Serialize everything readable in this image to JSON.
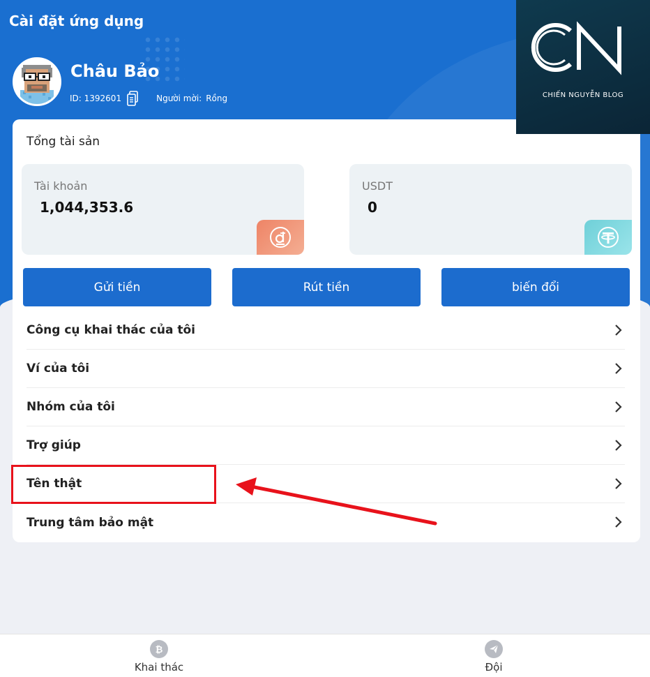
{
  "header": {
    "title": "Cài đặt ứng dụng"
  },
  "profile": {
    "name": "Châu Bảo",
    "id_text": "ID: 1392601",
    "inviter_label": "Người mời:",
    "inviter_value": "Rồng"
  },
  "brand": {
    "logo": "CN",
    "text": "CHIẾN NGUYỄN BLOG"
  },
  "assets": {
    "label": "Tổng tài sản",
    "accounts": [
      {
        "label": "Tài khoản",
        "value": "1,044,353.6",
        "icon": "dong-coin-icon"
      },
      {
        "label": "USDT",
        "value": "0",
        "icon": "tether-icon"
      }
    ]
  },
  "actions": {
    "deposit": "Gửi tiền",
    "withdraw": "Rút tiền",
    "convert": "biến đổi"
  },
  "menu": [
    "Công cụ khai thác của tôi",
    "Ví của tôi",
    "Nhóm của tôi",
    "Trợ giúp",
    "Tên thật",
    "Trung tâm bảo mật"
  ],
  "tabbar": {
    "mining": "Khai thác",
    "team": "Đội"
  },
  "colors": {
    "primary": "#1c6cce",
    "highlight": "#e8121b"
  }
}
